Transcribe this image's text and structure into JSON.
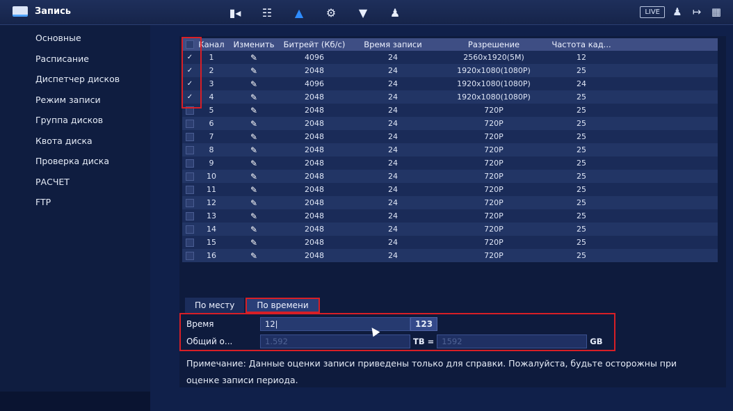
{
  "header": {
    "title": "Запись",
    "icons": [
      "camera-icon",
      "network-icon",
      "storage-icon",
      "settings-icon",
      "security-icon",
      "account-icon"
    ],
    "live_label": "LIVE",
    "right_icons": [
      "user-icon",
      "logout-icon",
      "qr-icon"
    ]
  },
  "sidebar": {
    "items": [
      {
        "label": "Основные"
      },
      {
        "label": "Расписание"
      },
      {
        "label": "Диспетчер дисков"
      },
      {
        "label": "Режим записи"
      },
      {
        "label": "Группа дисков"
      },
      {
        "label": "Квота диска"
      },
      {
        "label": "Проверка диска"
      },
      {
        "label": "РАСЧЕТ"
      },
      {
        "label": "FTP"
      }
    ]
  },
  "table": {
    "headers": {
      "channel": "Канал",
      "edit": "Изменить",
      "bitrate": "Битрейт (Кб/с)",
      "rec_time": "Время записи",
      "resolution": "Разрешение",
      "fps": "Частота кад..."
    },
    "rows": [
      {
        "checked": true,
        "channel": "1",
        "bitrate": "4096",
        "time": "24",
        "res": "2560x1920(5M)",
        "fps": "12"
      },
      {
        "checked": true,
        "channel": "2",
        "bitrate": "2048",
        "time": "24",
        "res": "1920x1080(1080P)",
        "fps": "25"
      },
      {
        "checked": true,
        "channel": "3",
        "bitrate": "4096",
        "time": "24",
        "res": "1920x1080(1080P)",
        "fps": "24"
      },
      {
        "checked": true,
        "channel": "4",
        "bitrate": "2048",
        "time": "24",
        "res": "1920x1080(1080P)",
        "fps": "25"
      },
      {
        "checked": false,
        "channel": "5",
        "bitrate": "2048",
        "time": "24",
        "res": "720P",
        "fps": "25"
      },
      {
        "checked": false,
        "channel": "6",
        "bitrate": "2048",
        "time": "24",
        "res": "720P",
        "fps": "25"
      },
      {
        "checked": false,
        "channel": "7",
        "bitrate": "2048",
        "time": "24",
        "res": "720P",
        "fps": "25"
      },
      {
        "checked": false,
        "channel": "8",
        "bitrate": "2048",
        "time": "24",
        "res": "720P",
        "fps": "25"
      },
      {
        "checked": false,
        "channel": "9",
        "bitrate": "2048",
        "time": "24",
        "res": "720P",
        "fps": "25"
      },
      {
        "checked": false,
        "channel": "10",
        "bitrate": "2048",
        "time": "24",
        "res": "720P",
        "fps": "25"
      },
      {
        "checked": false,
        "channel": "11",
        "bitrate": "2048",
        "time": "24",
        "res": "720P",
        "fps": "25"
      },
      {
        "checked": false,
        "channel": "12",
        "bitrate": "2048",
        "time": "24",
        "res": "720P",
        "fps": "25"
      },
      {
        "checked": false,
        "channel": "13",
        "bitrate": "2048",
        "time": "24",
        "res": "720P",
        "fps": "25"
      },
      {
        "checked": false,
        "channel": "14",
        "bitrate": "2048",
        "time": "24",
        "res": "720P",
        "fps": "25"
      },
      {
        "checked": false,
        "channel": "15",
        "bitrate": "2048",
        "time": "24",
        "res": "720P",
        "fps": "25"
      },
      {
        "checked": false,
        "channel": "16",
        "bitrate": "2048",
        "time": "24",
        "res": "720P",
        "fps": "25"
      }
    ]
  },
  "tabs": [
    {
      "label": "По месту"
    },
    {
      "label": "По времени"
    }
  ],
  "calc": {
    "time_label": "Время",
    "time_value": "12|",
    "time_unit": "123",
    "total_label": "Общий о...",
    "tb_value": "1.592",
    "tb_unit": "TB =",
    "gb_value": "1592",
    "gb_unit": "GB"
  },
  "note": "Примечание: Данные оценки записи приведены только для справки. Пожалуйста, будьте осторожны при оценке записи периода.",
  "colors": {
    "accent": "#2e8cff",
    "highlight": "#d81f26"
  }
}
